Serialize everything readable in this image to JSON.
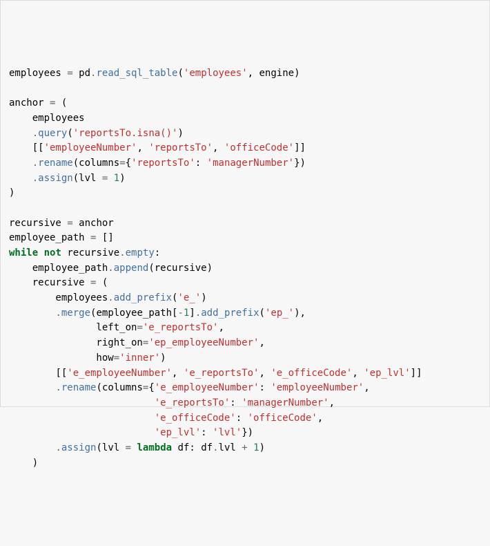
{
  "code": {
    "tokens": [
      [
        [
          "name",
          "employees"
        ],
        [
          "plain",
          " "
        ],
        [
          "op",
          "="
        ],
        [
          "plain",
          " pd"
        ],
        [
          "op",
          "."
        ],
        [
          "call",
          "read_sql_table"
        ],
        [
          "punct",
          "("
        ],
        [
          "str",
          "'employees'"
        ],
        [
          "punct",
          ","
        ],
        [
          "plain",
          " engine"
        ],
        [
          "punct",
          ")"
        ]
      ],
      [],
      [
        [
          "name",
          "anchor"
        ],
        [
          "plain",
          " "
        ],
        [
          "op",
          "="
        ],
        [
          "plain",
          " "
        ],
        [
          "punct",
          "("
        ]
      ],
      [
        [
          "plain",
          "    employees"
        ]
      ],
      [
        [
          "plain",
          "    "
        ],
        [
          "op",
          "."
        ],
        [
          "call",
          "query"
        ],
        [
          "punct",
          "("
        ],
        [
          "str",
          "'reportsTo.isna()'"
        ],
        [
          "punct",
          ")"
        ]
      ],
      [
        [
          "plain",
          "    "
        ],
        [
          "punct",
          "[["
        ],
        [
          "str",
          "'employeeNumber'"
        ],
        [
          "punct",
          ","
        ],
        [
          "plain",
          " "
        ],
        [
          "str",
          "'reportsTo'"
        ],
        [
          "punct",
          ","
        ],
        [
          "plain",
          " "
        ],
        [
          "str",
          "'officeCode'"
        ],
        [
          "punct",
          "]]"
        ]
      ],
      [
        [
          "plain",
          "    "
        ],
        [
          "op",
          "."
        ],
        [
          "call",
          "rename"
        ],
        [
          "punct",
          "("
        ],
        [
          "plain",
          "columns"
        ],
        [
          "op",
          "="
        ],
        [
          "punct",
          "{"
        ],
        [
          "str",
          "'reportsTo'"
        ],
        [
          "punct",
          ":"
        ],
        [
          "plain",
          " "
        ],
        [
          "str",
          "'managerNumber'"
        ],
        [
          "punct",
          "})"
        ]
      ],
      [
        [
          "plain",
          "    "
        ],
        [
          "op",
          "."
        ],
        [
          "call",
          "assign"
        ],
        [
          "punct",
          "("
        ],
        [
          "plain",
          "lvl "
        ],
        [
          "op",
          "="
        ],
        [
          "plain",
          " "
        ],
        [
          "num",
          "1"
        ],
        [
          "punct",
          ")"
        ]
      ],
      [
        [
          "punct",
          ")"
        ]
      ],
      [],
      [
        [
          "name",
          "recursive"
        ],
        [
          "plain",
          " "
        ],
        [
          "op",
          "="
        ],
        [
          "plain",
          " anchor"
        ]
      ],
      [
        [
          "name",
          "employee_path"
        ],
        [
          "plain",
          " "
        ],
        [
          "op",
          "="
        ],
        [
          "plain",
          " "
        ],
        [
          "punct",
          "[]"
        ]
      ],
      [
        [
          "kw",
          "while"
        ],
        [
          "plain",
          " "
        ],
        [
          "kw",
          "not"
        ],
        [
          "plain",
          " recursive"
        ],
        [
          "op",
          "."
        ],
        [
          "call",
          "empty"
        ],
        [
          "punct",
          ":"
        ]
      ],
      [
        [
          "plain",
          "    employee_path"
        ],
        [
          "op",
          "."
        ],
        [
          "call",
          "append"
        ],
        [
          "punct",
          "("
        ],
        [
          "plain",
          "recursive"
        ],
        [
          "punct",
          ")"
        ]
      ],
      [
        [
          "plain",
          "    recursive "
        ],
        [
          "op",
          "="
        ],
        [
          "plain",
          " "
        ],
        [
          "punct",
          "("
        ]
      ],
      [
        [
          "plain",
          "        employees"
        ],
        [
          "op",
          "."
        ],
        [
          "call",
          "add_prefix"
        ],
        [
          "punct",
          "("
        ],
        [
          "str",
          "'e_'"
        ],
        [
          "punct",
          ")"
        ]
      ],
      [
        [
          "plain",
          "        "
        ],
        [
          "op",
          "."
        ],
        [
          "call",
          "merge"
        ],
        [
          "punct",
          "("
        ],
        [
          "plain",
          "employee_path"
        ],
        [
          "punct",
          "["
        ],
        [
          "op",
          "-"
        ],
        [
          "num",
          "1"
        ],
        [
          "punct",
          "]"
        ],
        [
          "op",
          "."
        ],
        [
          "call",
          "add_prefix"
        ],
        [
          "punct",
          "("
        ],
        [
          "str",
          "'ep_'"
        ],
        [
          "punct",
          "),"
        ]
      ],
      [
        [
          "plain",
          "               left_on"
        ],
        [
          "op",
          "="
        ],
        [
          "str",
          "'e_reportsTo'"
        ],
        [
          "punct",
          ","
        ]
      ],
      [
        [
          "plain",
          "               right_on"
        ],
        [
          "op",
          "="
        ],
        [
          "str",
          "'ep_employeeNumber'"
        ],
        [
          "punct",
          ","
        ]
      ],
      [
        [
          "plain",
          "               how"
        ],
        [
          "op",
          "="
        ],
        [
          "str",
          "'inner'"
        ],
        [
          "punct",
          ")"
        ]
      ],
      [
        [
          "plain",
          "        "
        ],
        [
          "punct",
          "[["
        ],
        [
          "str",
          "'e_employeeNumber'"
        ],
        [
          "punct",
          ","
        ],
        [
          "plain",
          " "
        ],
        [
          "str",
          "'e_reportsTo'"
        ],
        [
          "punct",
          ","
        ],
        [
          "plain",
          " "
        ],
        [
          "str",
          "'e_officeCode'"
        ],
        [
          "punct",
          ","
        ],
        [
          "plain",
          " "
        ],
        [
          "str",
          "'ep_lvl'"
        ],
        [
          "punct",
          "]]"
        ]
      ],
      [
        [
          "plain",
          "        "
        ],
        [
          "op",
          "."
        ],
        [
          "call",
          "rename"
        ],
        [
          "punct",
          "("
        ],
        [
          "plain",
          "columns"
        ],
        [
          "op",
          "="
        ],
        [
          "punct",
          "{"
        ],
        [
          "str",
          "'e_employeeNumber'"
        ],
        [
          "punct",
          ":"
        ],
        [
          "plain",
          " "
        ],
        [
          "str",
          "'employeeNumber'"
        ],
        [
          "punct",
          ","
        ]
      ],
      [
        [
          "plain",
          "                         "
        ],
        [
          "str",
          "'e_reportsTo'"
        ],
        [
          "punct",
          ":"
        ],
        [
          "plain",
          " "
        ],
        [
          "str",
          "'managerNumber'"
        ],
        [
          "punct",
          ","
        ]
      ],
      [
        [
          "plain",
          "                         "
        ],
        [
          "str",
          "'e_officeCode'"
        ],
        [
          "punct",
          ":"
        ],
        [
          "plain",
          " "
        ],
        [
          "str",
          "'officeCode'"
        ],
        [
          "punct",
          ","
        ]
      ],
      [
        [
          "plain",
          "                         "
        ],
        [
          "str",
          "'ep_lvl'"
        ],
        [
          "punct",
          ":"
        ],
        [
          "plain",
          " "
        ],
        [
          "str",
          "'lvl'"
        ],
        [
          "punct",
          "})"
        ]
      ],
      [
        [
          "plain",
          "        "
        ],
        [
          "op",
          "."
        ],
        [
          "call",
          "assign"
        ],
        [
          "punct",
          "("
        ],
        [
          "plain",
          "lvl "
        ],
        [
          "op",
          "="
        ],
        [
          "plain",
          " "
        ],
        [
          "kw",
          "lambda"
        ],
        [
          "plain",
          " df"
        ],
        [
          "punct",
          ":"
        ],
        [
          "plain",
          " df"
        ],
        [
          "op",
          "."
        ],
        [
          "plain",
          "lvl "
        ],
        [
          "op",
          "+"
        ],
        [
          "plain",
          " "
        ],
        [
          "num",
          "1"
        ],
        [
          "punct",
          ")"
        ]
      ],
      [
        [
          "plain",
          "    "
        ],
        [
          "punct",
          ")"
        ]
      ]
    ]
  }
}
